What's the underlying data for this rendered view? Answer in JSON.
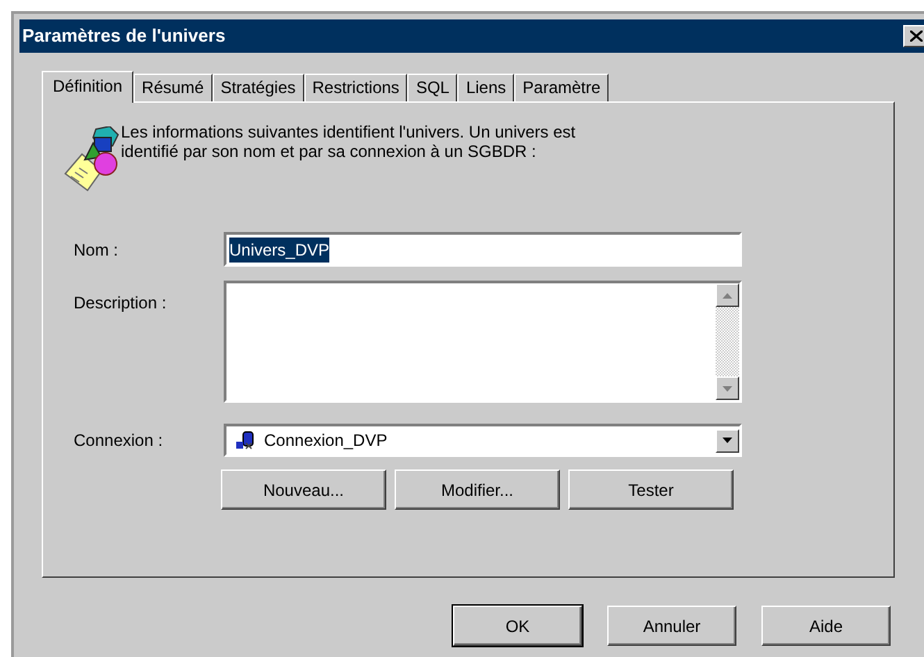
{
  "window": {
    "title": "Paramètres de l'univers"
  },
  "tabs": [
    {
      "label": "Définition",
      "selected": true
    },
    {
      "label": "Résumé",
      "selected": false
    },
    {
      "label": "Stratégies",
      "selected": false
    },
    {
      "label": "Restrictions",
      "selected": false
    },
    {
      "label": "SQL",
      "selected": false
    },
    {
      "label": "Liens",
      "selected": false
    },
    {
      "label": "Paramètre",
      "selected": false
    }
  ],
  "intro": "Les informations suivantes identifient l'univers. Un univers est identifié par son nom et par sa connexion à un SGBDR :",
  "name_field": {
    "label": "Nom :",
    "value": "Univers_DVP",
    "text_selected": true
  },
  "description_field": {
    "label": "Description :"
  },
  "connection_field": {
    "label": "Connexion :",
    "value": "Connexion_DVP"
  },
  "connection_buttons": [
    "Nouveau...",
    "Modifier...",
    "Tester"
  ],
  "dialog_buttons": [
    {
      "label": "OK",
      "default": true
    },
    {
      "label": "Annuler",
      "default": false
    },
    {
      "label": "Aide",
      "default": false
    }
  ]
}
